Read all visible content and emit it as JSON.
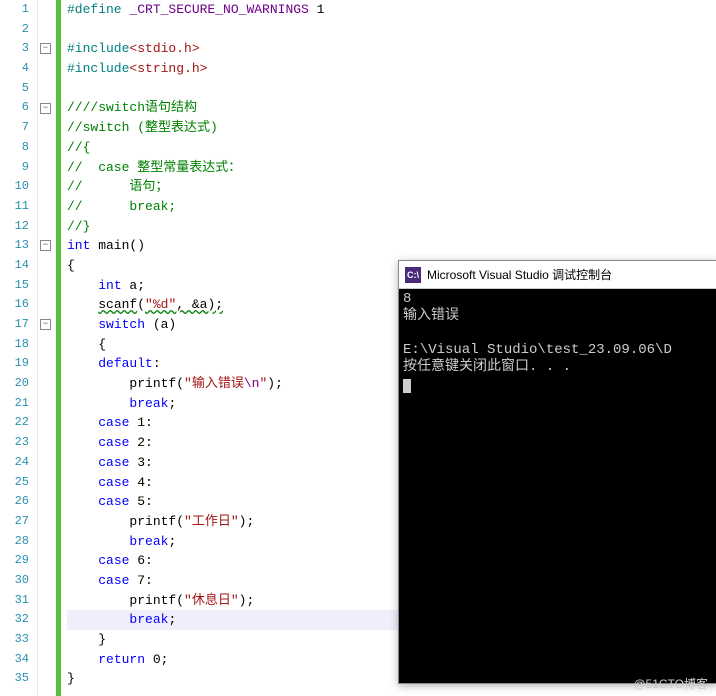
{
  "lineCount": 35,
  "folds": [
    {
      "line": 3,
      "sym": "−"
    },
    {
      "line": 6,
      "sym": "−"
    },
    {
      "line": 13,
      "sym": "−"
    },
    {
      "line": 17,
      "sym": "−"
    }
  ],
  "code": {
    "l1_define": "#define",
    "l1_macro": "_CRT_SECURE_NO_WARNINGS",
    "l1_one": " 1",
    "l3_inc": "#include",
    "l3_hdr": "<stdio.h>",
    "l4_inc": "#include",
    "l4_hdr": "<string.h>",
    "l6": "////switch语句结构",
    "l7": "//switch (整型表达式)",
    "l8": "//{",
    "l9": "//  case 整型常量表达式：",
    "l10": "//      语句；",
    "l11": "//      break;",
    "l12": "//}",
    "l13_int": "int",
    "l13_main": " main()",
    "l14": "{",
    "l15_int": "int",
    "l15_rest": " a;",
    "l16_scanf": "scanf",
    "l16_open": "(",
    "l16_fmt": "\"%d\"",
    "l16_rest": ", &a);",
    "l17_switch": "switch",
    "l17_rest": " (a)",
    "l18": "{",
    "l19_default": "default",
    "l19_colon": ":",
    "l20_printf": "printf",
    "l20_open": "(",
    "l20_str": "\"输入错误",
    "l20_esc": "\\n",
    "l20_close": "\"",
    "l20_end": ");",
    "l21_break": "break",
    "l21_semi": ";",
    "l22_case": "case",
    "l22_rest": " 1:",
    "l23_case": "case",
    "l23_rest": " 2:",
    "l24_case": "case",
    "l24_rest": " 3:",
    "l25_case": "case",
    "l25_rest": " 4:",
    "l26_case": "case",
    "l26_rest": " 5:",
    "l27_printf": "printf",
    "l27_open": "(",
    "l27_str": "\"工作日\"",
    "l27_end": ");",
    "l28_break": "break",
    "l28_semi": ";",
    "l29_case": "case",
    "l29_rest": " 6:",
    "l30_case": "case",
    "l30_rest": " 7:",
    "l31_printf": "printf",
    "l31_open": "(",
    "l31_str": "\"休息日\"",
    "l31_end": ");",
    "l32_break": "break",
    "l32_semi": ";",
    "l33": "}",
    "l34_return": "return",
    "l34_rest": " 0;",
    "l35": "}"
  },
  "console": {
    "icon": "C:\\",
    "title": "Microsoft Visual Studio 调试控制台",
    "out1": "8",
    "out2": "输入错误",
    "out3": "",
    "out4": "E:\\Visual Studio\\test_23.09.06\\D",
    "out5": "按任意键关闭此窗口. . ."
  },
  "watermark": "@51CTO博客"
}
